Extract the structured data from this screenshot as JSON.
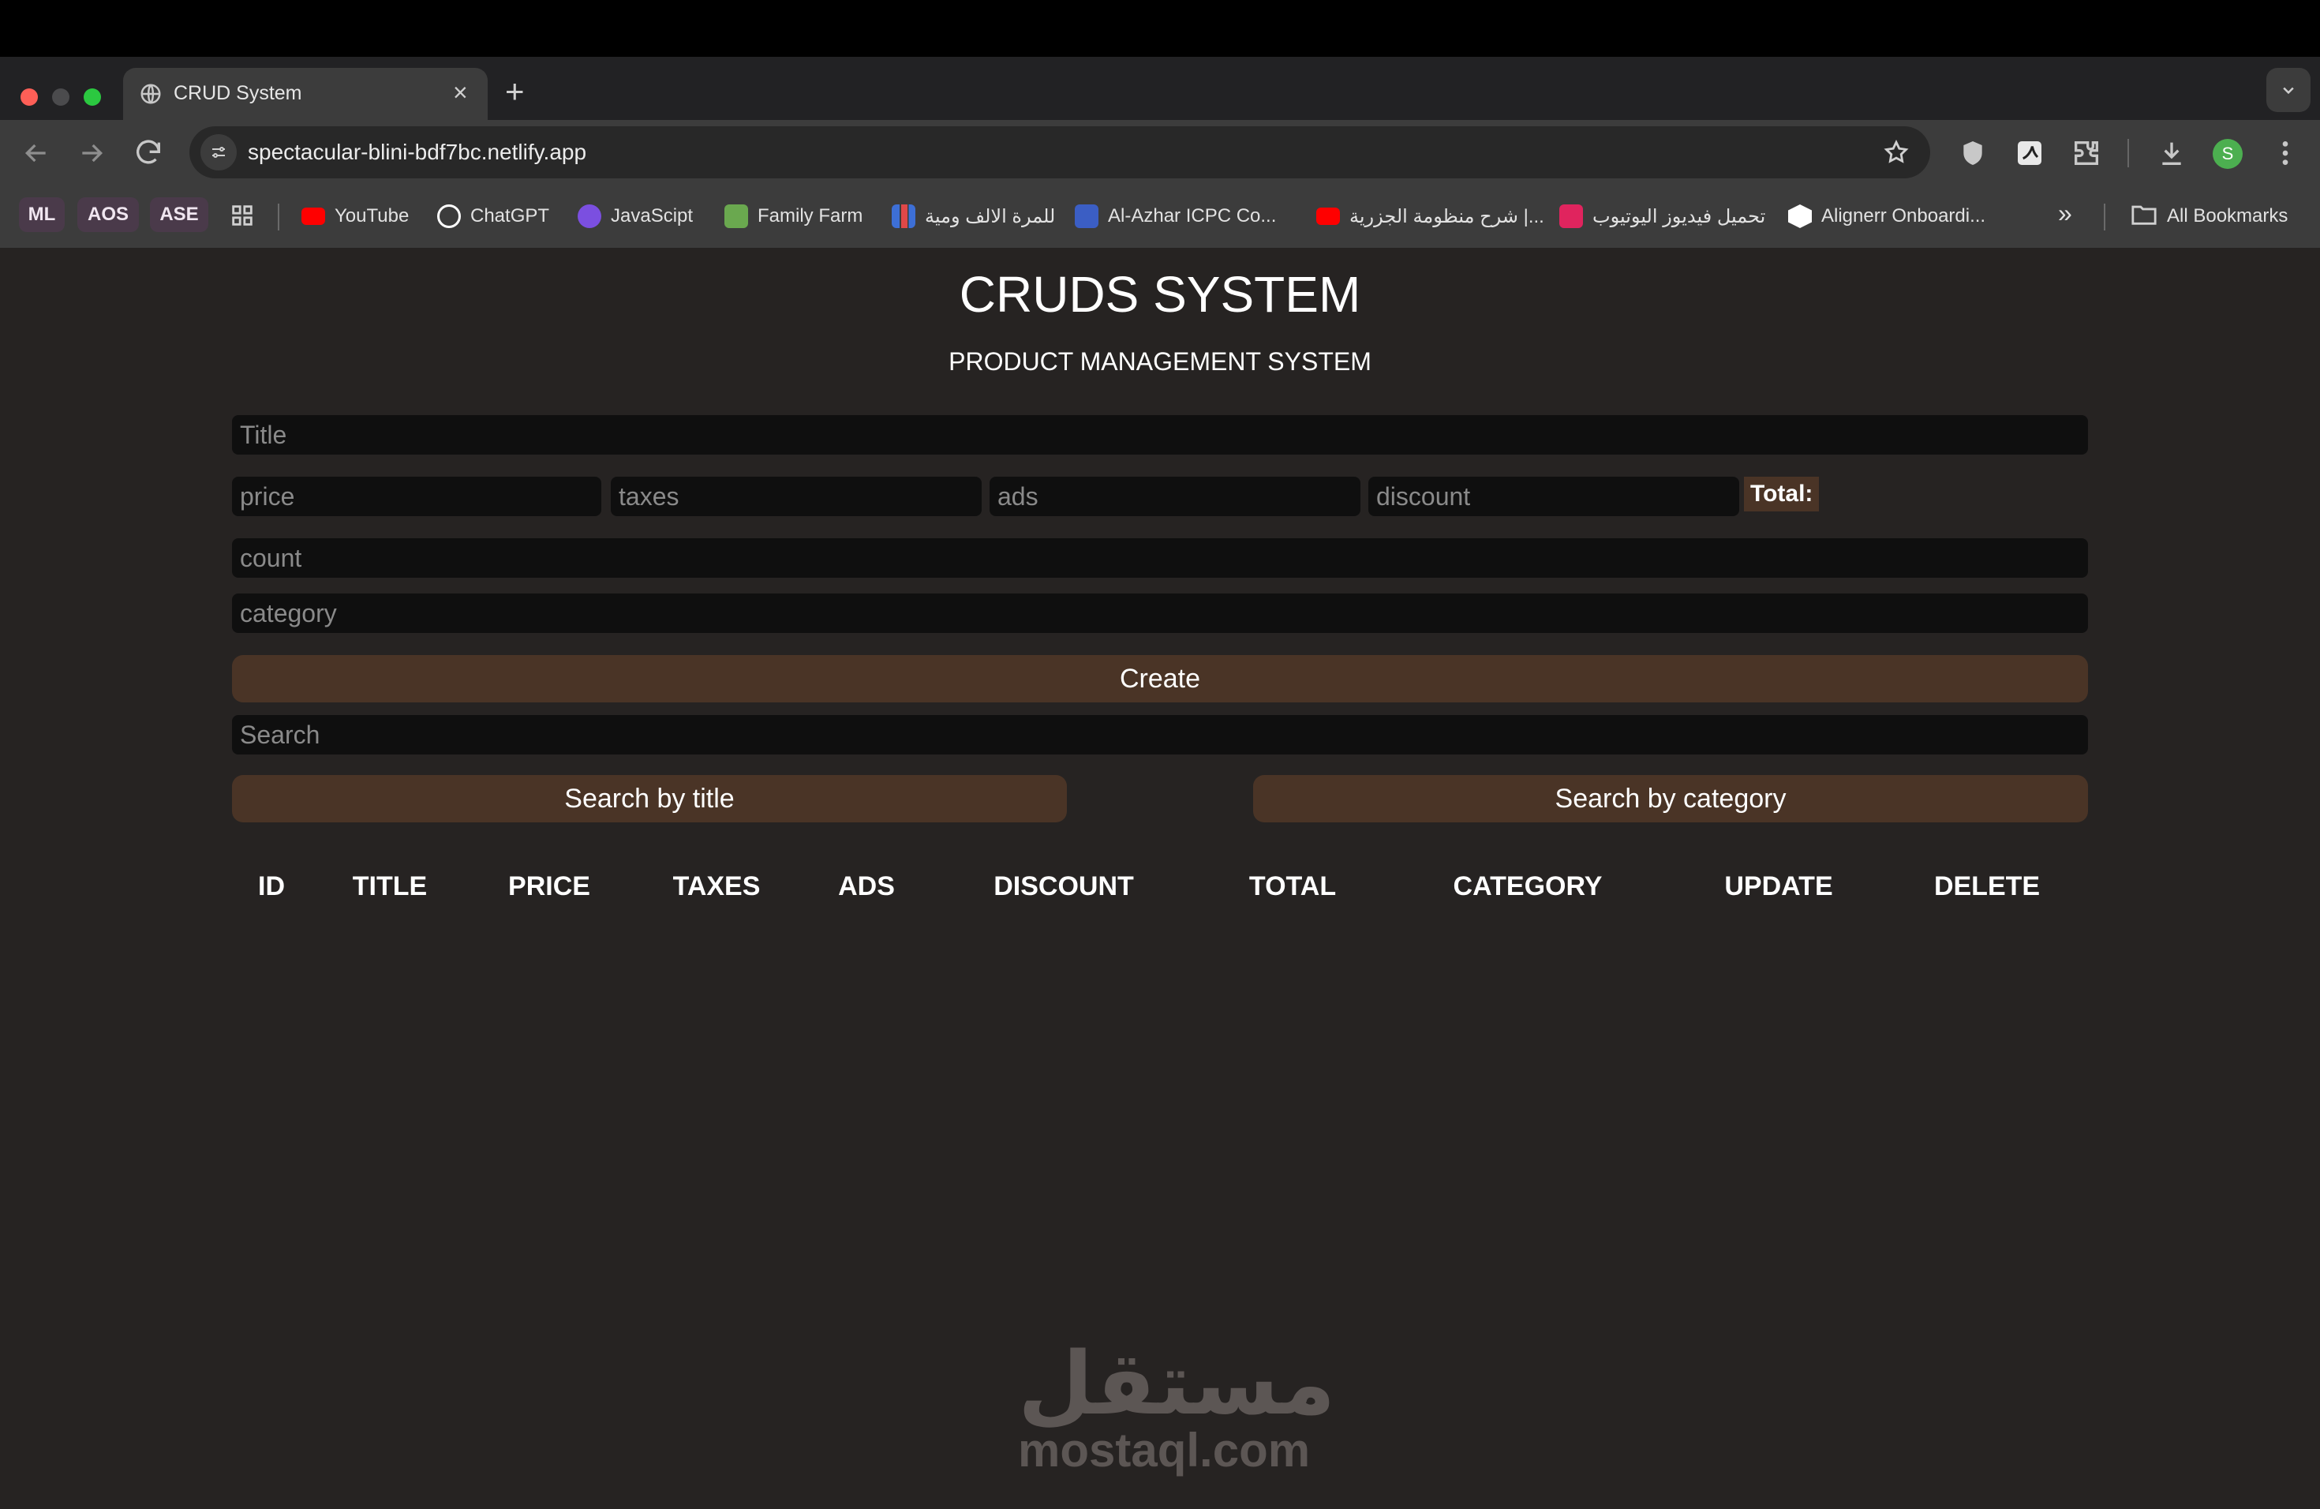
{
  "browser": {
    "tab_title": "CRUD System",
    "tab_close_glyph": "×",
    "new_tab_glyph": "+",
    "url": "spectacular-blini-bdf7bc.netlify.app",
    "profile_initial": "S",
    "bookmarks": [
      {
        "label": "ML"
      },
      {
        "label": "AOS"
      },
      {
        "label": "ASE"
      },
      {
        "label": "YouTube",
        "icon_color": "#ff0000"
      },
      {
        "label": "ChatGPT",
        "icon_color": "#ffffff"
      },
      {
        "label": "JavaScipt",
        "icon_color": "#7b4fe0"
      },
      {
        "label": "Family Farm",
        "icon_color": "#6aa84f"
      },
      {
        "label": "للمرة الالف ومية",
        "icon_color": "#3d6fd6"
      },
      {
        "label": "Al-Azhar ICPC Co...",
        "icon_color": "#3b5ec4"
      },
      {
        "label": "شرح منظومة الجزرية |...",
        "icon_color": "#ff0000"
      },
      {
        "label": "تحميل فيديوز اليوتيوب",
        "icon_color": "#e0245e"
      },
      {
        "label": "Alignerr Onboardi...",
        "icon_color": "#ffffff"
      }
    ],
    "overflow_glyph": "»",
    "all_bookmarks": "All Bookmarks"
  },
  "app": {
    "title": "CRUDS SYSTEM",
    "subtitle": "PRODUCT MANAGEMENT SYSTEM",
    "placeholders": {
      "title": "Title",
      "price": "price",
      "taxes": "taxes",
      "ads": "ads",
      "discount": "discount",
      "count": "count",
      "category": "category",
      "search": "Search"
    },
    "total_label": "Total:",
    "create_label": "Create",
    "search_title_label": "Search by title",
    "search_category_label": "Search by category",
    "table_headers": [
      "ID",
      "TITLE",
      "PRICE",
      "TAXES",
      "ADS",
      "DISCOUNT",
      "TOTAL",
      "CATEGORY",
      "UPDATE",
      "DELETE"
    ],
    "accent_color": "#4a3426",
    "input_bg": "#0f0f0f",
    "page_bg": "#262322"
  },
  "watermark": {
    "arabic": "مستقل",
    "latin": "mostaql.com"
  }
}
